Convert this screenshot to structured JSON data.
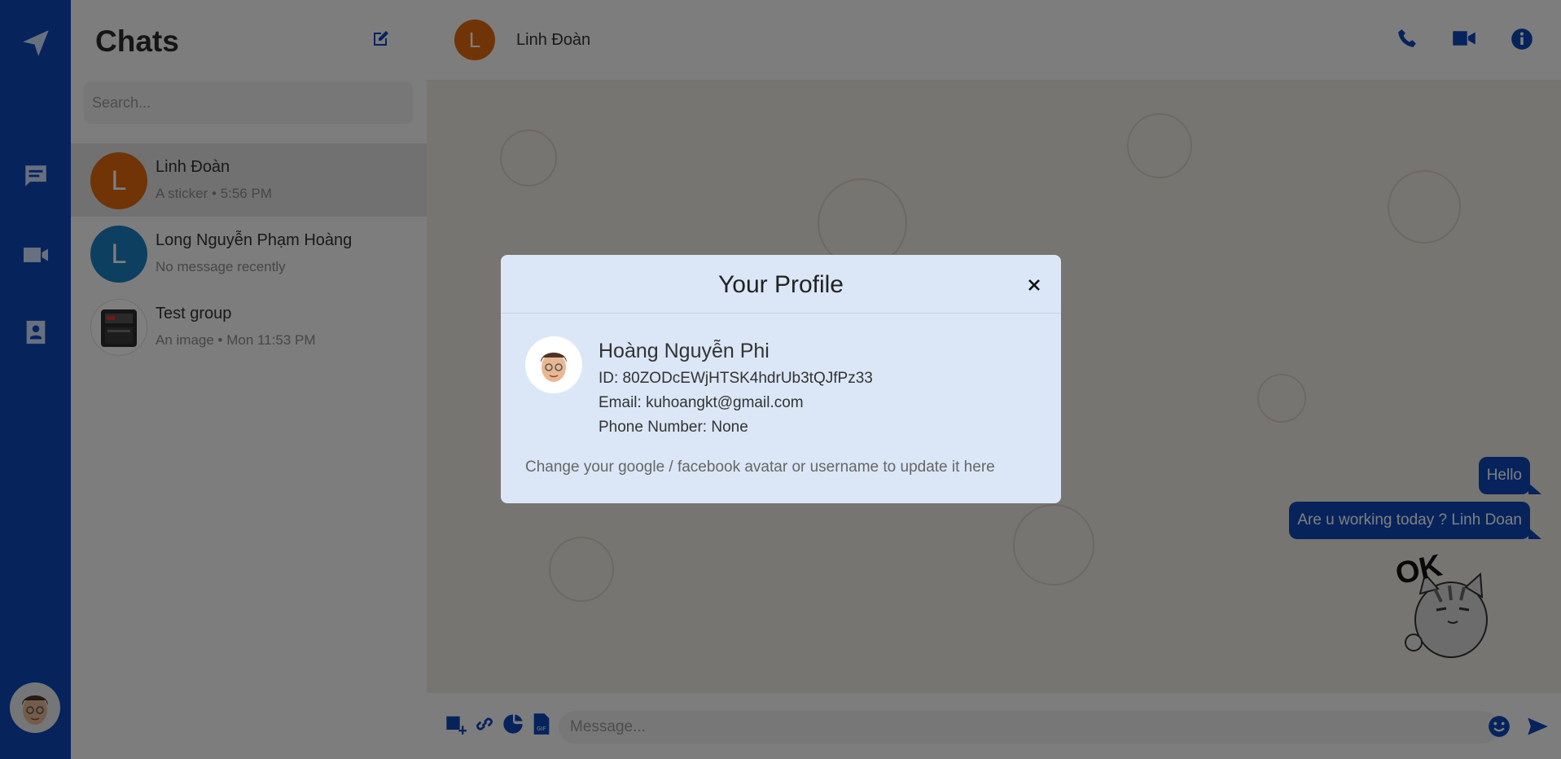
{
  "sidebar": {
    "title": "Chats",
    "search_placeholder": "Search...",
    "conversations": [
      {
        "initial": "L",
        "name": "Linh Đoàn",
        "subtitle": "A sticker • 5:56 PM",
        "avatar_color": "#e0680f"
      },
      {
        "initial": "L",
        "name": "Long Nguyễn Phạm Hoàng",
        "subtitle": "No message recently",
        "avatar_color": "#1a7fc1"
      },
      {
        "name": "Test group",
        "subtitle": "An image • Mon 11:53 PM"
      }
    ]
  },
  "chat": {
    "initial": "L",
    "name": "Linh Đoàn",
    "messages": [
      "Hello",
      "Are u working today ? Linh Doan"
    ],
    "sticker_text": "OK",
    "composer_placeholder": "Message..."
  },
  "modal": {
    "title": "Your Profile",
    "name": "Hoàng Nguyễn Phi",
    "id_line": "ID: 80ZODcEWjHTSK4hdrUb3tQJfPz33",
    "email_line": "Email: kuhoangkt@gmail.com",
    "phone_line": "Phone Number: None",
    "hint": "Change your google / facebook avatar or username to update it here"
  },
  "colors": {
    "brand": "#0d47b8",
    "modal_bg": "#dbe7f6",
    "chat_bg": "#efeae2"
  },
  "icons": [
    "paper-plane-icon",
    "chat-icon",
    "video-icon",
    "contacts-icon",
    "compose-icon",
    "phone-icon",
    "video-call-icon",
    "info-icon",
    "add-image-icon",
    "link-icon",
    "sticker-icon",
    "gif-icon",
    "emoji-icon",
    "send-icon",
    "close-icon"
  ]
}
